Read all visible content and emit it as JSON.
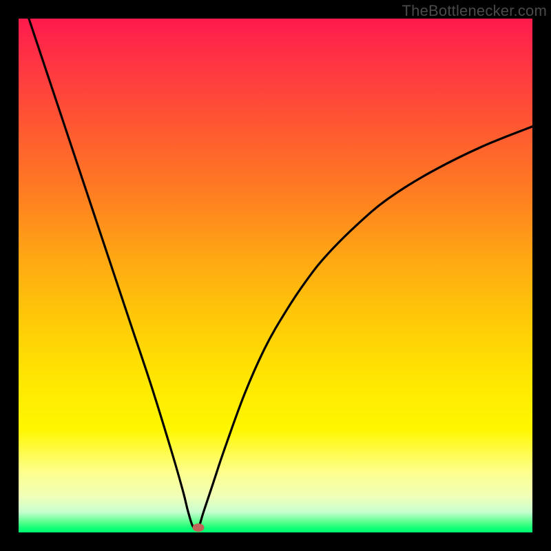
{
  "watermark": "TheBottleneсker.com",
  "chart_data": {
    "type": "line",
    "title": "",
    "xlabel": "",
    "ylabel": "",
    "xlim": [
      0,
      100
    ],
    "ylim": [
      0,
      100
    ],
    "notch_x": 34,
    "marker": {
      "x": 35,
      "y": 99
    },
    "series": [
      {
        "name": "curve",
        "x": [
          2,
          6,
          10,
          14,
          18,
          22,
          26,
          30,
          32,
          33,
          34,
          35,
          36,
          38,
          40,
          44,
          48,
          52,
          56,
          60,
          66,
          72,
          80,
          90,
          100
        ],
        "y": [
          0,
          12,
          24,
          36,
          48,
          60,
          72,
          85,
          92,
          96,
          99,
          99,
          96,
          90,
          84,
          73,
          64,
          57,
          51,
          46,
          40,
          35,
          30,
          25,
          21
        ]
      }
    ],
    "gradient_stops": [
      {
        "pos": 0,
        "color": "#ff1a4d"
      },
      {
        "pos": 20,
        "color": "#ff5533"
      },
      {
        "pos": 45,
        "color": "#ffa215"
      },
      {
        "pos": 70,
        "color": "#ffe602"
      },
      {
        "pos": 93,
        "color": "#f0ffb8"
      },
      {
        "pos": 100,
        "color": "#00ff73"
      }
    ]
  }
}
